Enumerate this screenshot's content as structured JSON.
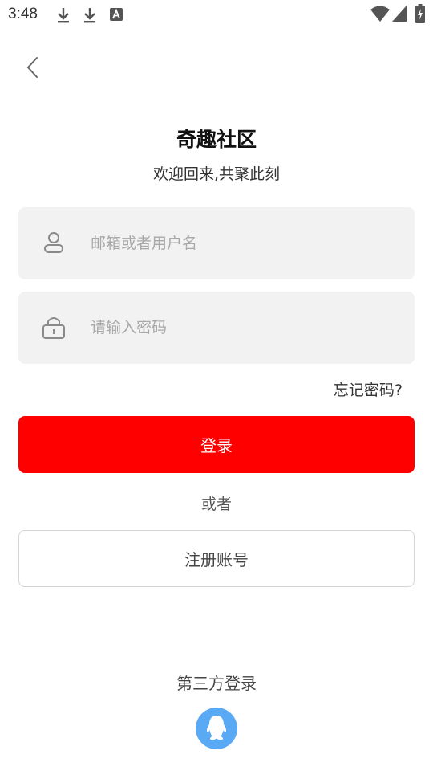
{
  "status_bar": {
    "time": "3:48",
    "icons": [
      "download-icon",
      "download-icon",
      "keyboard-a-icon",
      "wifi-icon",
      "signal-icon",
      "battery-charging-icon"
    ]
  },
  "header": {
    "back_icon": "chevron-left-icon"
  },
  "app": {
    "title": "奇趣社区",
    "subtitle": "欢迎回来,共聚此刻"
  },
  "form": {
    "username": {
      "icon": "user-icon",
      "placeholder": "邮箱或者用户名",
      "value": ""
    },
    "password": {
      "icon": "lock-icon",
      "placeholder": "请输入密码",
      "value": ""
    },
    "forgot_label": "忘记密码?",
    "login_label": "登录",
    "or_label": "或者",
    "register_label": "注册账号"
  },
  "third_party": {
    "label": "第三方登录",
    "providers": [
      {
        "icon": "qq-icon"
      }
    ]
  },
  "colors": {
    "accent": "#ff0000",
    "field_bg": "#f2f2f2",
    "qq_blue": "#5aa9f5"
  }
}
